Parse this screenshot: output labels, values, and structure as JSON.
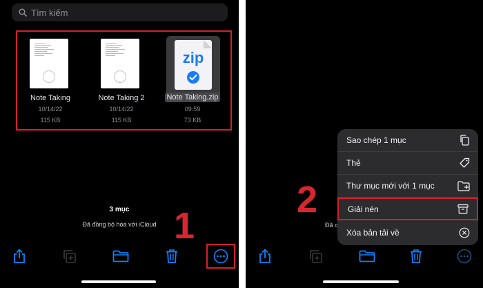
{
  "search": {
    "placeholder": "Tìm kiếm",
    "icon": "search-icon"
  },
  "files": [
    {
      "name": "Note Taking",
      "date": "10/14/22",
      "size": "115 KB",
      "type": "document"
    },
    {
      "name": "Note Taking 2",
      "date": "10/14/22",
      "size": "115 KB",
      "type": "document"
    },
    {
      "name": "Note Taking.zip",
      "date": "09:59",
      "size": "73 KB",
      "type": "zip",
      "selected": true,
      "thumb_label": "zip"
    }
  ],
  "footer": {
    "count": "3 mục",
    "sync": "Đã đồng bộ hóa với iCloud"
  },
  "toolbar": {
    "icons": [
      "share-icon",
      "duplicate-icon",
      "folder-icon",
      "trash-icon",
      "more-icon"
    ]
  },
  "annotations": {
    "step1": "1",
    "step2": "2"
  },
  "menu": {
    "items": [
      {
        "label": "Sao chép 1 mục",
        "icon": "copy-icon"
      },
      {
        "label": "Thẻ",
        "icon": "tag-icon"
      },
      {
        "label": "Thư mục mới với 1 mục",
        "icon": "new-folder-icon"
      },
      {
        "label": "Giải nén",
        "icon": "archive-icon",
        "highlighted": true
      },
      {
        "label": "Xóa bản tải về",
        "icon": "remove-download-icon"
      }
    ]
  },
  "right_footer": {
    "sync_truncated": "Đã c"
  },
  "colors": {
    "accent": "#0a84ff",
    "highlight": "#d4202c",
    "background": "#000000",
    "menu": "#2c2c2e"
  }
}
